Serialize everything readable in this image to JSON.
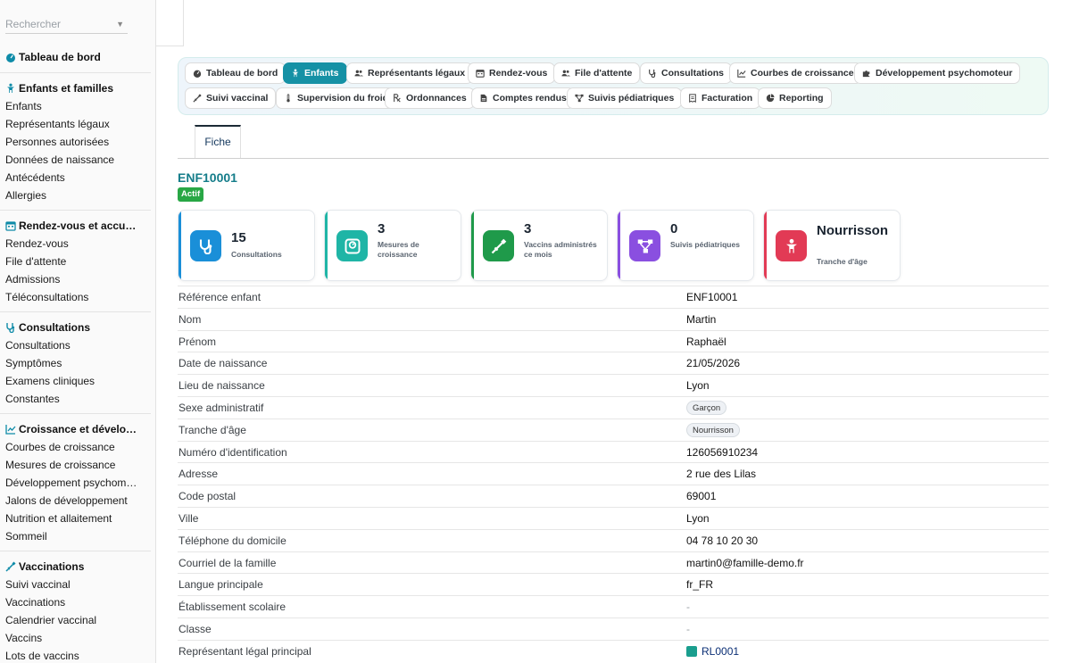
{
  "sidebar": {
    "search_placeholder": "Rechercher",
    "dashboard": "Tableau de bord",
    "sections": [
      {
        "title": "Enfants et familles",
        "icon": "child-icon",
        "items": [
          "Enfants",
          "Représentants légaux",
          "Personnes autorisées",
          "Données de naissance",
          "Antécédents",
          "Allergies"
        ]
      },
      {
        "title": "Rendez-vous et accu…",
        "icon": "calendar-icon",
        "items": [
          "Rendez-vous",
          "File d'attente",
          "Admissions",
          "Téléconsultations"
        ]
      },
      {
        "title": "Consultations",
        "icon": "stethoscope-icon",
        "items": [
          "Consultations",
          "Symptômes",
          "Examens cliniques",
          "Constantes"
        ]
      },
      {
        "title": "Croissance et dévelo…",
        "icon": "chart-line-icon",
        "items": [
          "Courbes de croissance",
          "Mesures de croissance",
          "Développement psychom…",
          "Jalons de développement",
          "Nutrition et allaitement",
          "Sommeil"
        ]
      },
      {
        "title": "Vaccinations",
        "icon": "syringe-icon",
        "items": [
          "Suivi vaccinal",
          "Vaccinations",
          "Calendrier vaccinal",
          "Vaccins",
          "Lots de vaccins"
        ]
      }
    ]
  },
  "nav": {
    "row1": [
      {
        "label": "Tableau de bord",
        "icon": "gauge-icon"
      },
      {
        "label": "Enfants",
        "icon": "child-icon",
        "active": true
      },
      {
        "label": "Représentants légaux",
        "icon": "users-icon"
      },
      {
        "label": "Rendez-vous",
        "icon": "calendar-icon"
      },
      {
        "label": "File d'attente",
        "icon": "users-icon"
      },
      {
        "label": "Consultations",
        "icon": "stethoscope-icon"
      },
      {
        "label": "Courbes de croissance",
        "icon": "chart-line-icon"
      },
      {
        "label": "Développement psychomoteur",
        "icon": "puzzle-icon"
      }
    ],
    "row2": [
      {
        "label": "Suivi vaccinal",
        "icon": "syringe-icon"
      },
      {
        "label": "Supervision du froid",
        "icon": "thermometer-icon"
      },
      {
        "label": "Ordonnances",
        "icon": "prescription-icon"
      },
      {
        "label": "Comptes rendus",
        "icon": "file-icon"
      },
      {
        "label": "Suivis pédiatriques",
        "icon": "diagram-icon"
      },
      {
        "label": "Facturation",
        "icon": "invoice-icon"
      },
      {
        "label": "Reporting",
        "icon": "pie-chart-icon"
      }
    ]
  },
  "tab": {
    "label": "Fiche"
  },
  "record": {
    "id": "ENF10001",
    "status": "Actif"
  },
  "stats": [
    {
      "value": "15",
      "label": "Consultations",
      "icon": "stethoscope-icon",
      "color": "#1a8fd8"
    },
    {
      "value": "3",
      "label": "Mesures de croissance",
      "icon": "weight-scale-icon",
      "color": "#1fb5a6"
    },
    {
      "value": "3",
      "label": "Vaccins administrés ce mois",
      "icon": "syringe-icon",
      "color": "#1f9a4a"
    },
    {
      "value": "0",
      "label": "Suivis pédiatriques",
      "icon": "diagram-icon",
      "color": "#8a4fe0"
    },
    {
      "value": "Nourrisson",
      "label": "Tranche d'âge",
      "icon": "child-icon",
      "color": "#e23a55"
    }
  ],
  "details": [
    {
      "key": "Référence enfant",
      "value": "ENF10001"
    },
    {
      "key": "Nom",
      "value": "Martin"
    },
    {
      "key": "Prénom",
      "value": "Raphaël"
    },
    {
      "key": "Date de naissance",
      "value": "21/05/2026"
    },
    {
      "key": "Lieu de naissance",
      "value": "Lyon"
    },
    {
      "key": "Sexe administratif",
      "value": "Garçon",
      "type": "chip"
    },
    {
      "key": "Tranche d'âge",
      "value": "Nourrisson",
      "type": "chip"
    },
    {
      "key": "Numéro d'identification",
      "value": "126056910234"
    },
    {
      "key": "Adresse",
      "value": "2 rue des Lilas"
    },
    {
      "key": "Code postal",
      "value": "69001"
    },
    {
      "key": "Ville",
      "value": "Lyon"
    },
    {
      "key": "Téléphone du domicile",
      "value": "04 78 10 20 30"
    },
    {
      "key": "Courriel de la famille",
      "value": "martin0@famille-demo.fr"
    },
    {
      "key": "Langue principale",
      "value": "fr_FR"
    },
    {
      "key": "Établissement scolaire",
      "value": "-",
      "type": "dash"
    },
    {
      "key": "Classe",
      "value": "-",
      "type": "dash"
    },
    {
      "key": "Représentant légal principal",
      "value": "RL0001",
      "type": "link"
    }
  ],
  "colors": {
    "accent": "#1591a5",
    "status": "#28a745"
  }
}
